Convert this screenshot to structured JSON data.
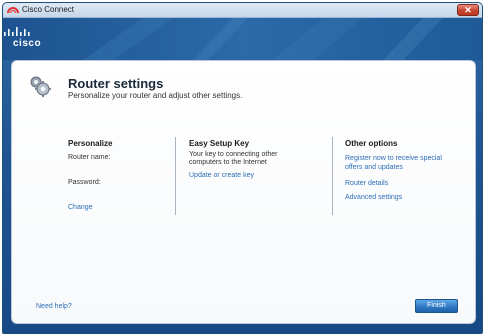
{
  "window": {
    "title": "Cisco Connect",
    "close_label": "✕"
  },
  "banner": {
    "logo_text": "cisco"
  },
  "header": {
    "title": "Router settings",
    "subtitle": "Personalize your router and adjust other settings."
  },
  "personalize": {
    "heading": "Personalize",
    "router_name_label": "Router name:",
    "password_label": "Password:",
    "change_link": "Change"
  },
  "easy_setup": {
    "heading": "Easy Setup Key",
    "description_line1": "Your key to connecting other",
    "description_line2": "computers to the Internet",
    "update_link": "Update or create key"
  },
  "other_options": {
    "heading": "Other options",
    "register_link_line1": "Register now to receive special",
    "register_link_line2": "offers and updates",
    "router_details_link": "Router details",
    "advanced_settings_link": "Advanced settings"
  },
  "footer": {
    "need_help_link": "Need help?",
    "finish_label": "Finish"
  },
  "colors": {
    "link": "#2d6fb6",
    "banner": "#1f5592",
    "finish_button": "#2e77c2",
    "close_button": "#c84530"
  },
  "icons": [
    "cisco-app-icon",
    "cisco-logo-icon",
    "gear-icon",
    "close-icon"
  ]
}
